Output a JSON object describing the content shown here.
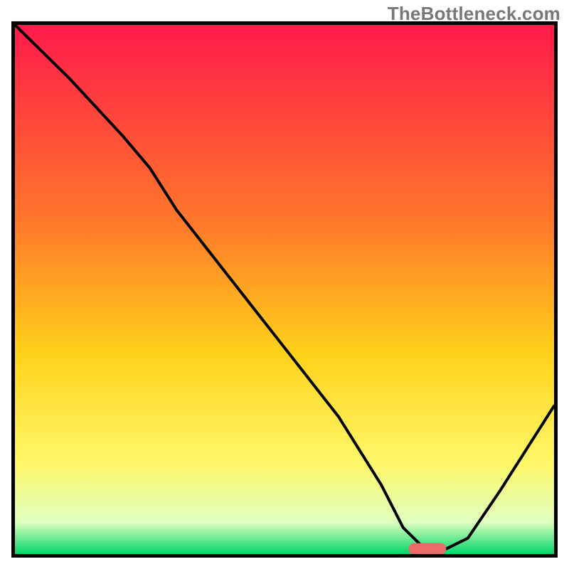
{
  "watermark": "TheBottleneck.com",
  "colors": {
    "gradient_top": "#ff1a4a",
    "gradient_mid1": "#ff7a2a",
    "gradient_mid2": "#ffd21a",
    "gradient_mid3": "#fff86a",
    "gradient_bottom_light": "#dfffbf",
    "gradient_bottom": "#00d66a",
    "curve": "#000000",
    "marker": "#ea6a6a"
  },
  "chart_data": {
    "type": "line",
    "title": "",
    "xlabel": "",
    "ylabel": "",
    "xlim": [
      0,
      100
    ],
    "ylim": [
      0,
      100
    ],
    "grid": false,
    "legend": false,
    "annotations": [
      "TheBottleneck.com"
    ],
    "series": [
      {
        "name": "bottleneck-curve",
        "x": [
          0,
          10,
          20,
          25,
          30,
          40,
          50,
          60,
          68,
          72,
          76,
          80,
          84,
          90,
          100
        ],
        "y": [
          100,
          90,
          79,
          73,
          65,
          52,
          39,
          26,
          13,
          5,
          1,
          1,
          3,
          12,
          28
        ]
      }
    ],
    "marker": {
      "x_range": [
        73,
        80
      ],
      "y": 1,
      "color": "#ea6a6a"
    }
  }
}
